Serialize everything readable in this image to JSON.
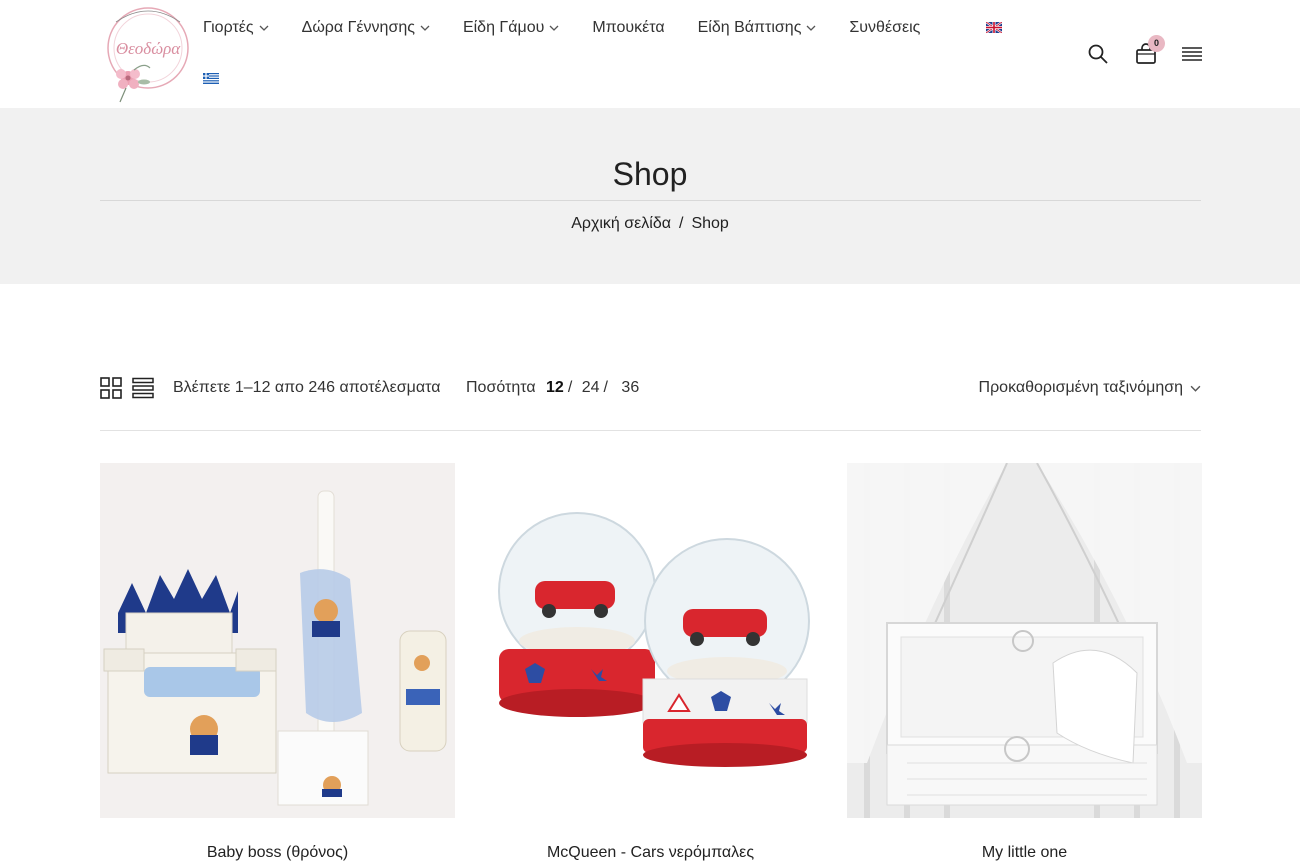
{
  "brand": {
    "logo_text": "Θεοδώρα",
    "logo_ring_text": "Floral Art & Event Design"
  },
  "nav": {
    "items": [
      {
        "label": "Γιορτές",
        "has_dropdown": true
      },
      {
        "label": "Δώρα Γέννησης",
        "has_dropdown": true
      },
      {
        "label": "Είδη Γάμου",
        "has_dropdown": true
      },
      {
        "label": "Μπουκέτα",
        "has_dropdown": false
      },
      {
        "label": "Είδη Βάπτισης",
        "has_dropdown": true
      },
      {
        "label": "Συνθέσεις",
        "has_dropdown": false
      }
    ],
    "languages": [
      "uk-flag-icon",
      "greek-flag-icon"
    ]
  },
  "header_icons": {
    "search": "search-icon",
    "cart": "cart-icon",
    "menu": "hamburger-menu-icon",
    "cart_count": "0"
  },
  "page": {
    "title": "Shop",
    "breadcrumb": {
      "home": "Αρχική σελίδα",
      "separator": "/",
      "current": "Shop"
    }
  },
  "toolbar": {
    "result_count": "Βλέπετε 1–12 απο 246 αποτέλεσματα",
    "quantity_label": "Ποσότητα",
    "quantity_options": [
      "12",
      "24",
      "36"
    ],
    "quantity_selected": "12",
    "sort_label": "Προκαθορισμένη ταξινόμηση"
  },
  "products": [
    {
      "name": "Baby boss (θρόνος)"
    },
    {
      "name": "McQueen - Cars νερόμπαλες"
    },
    {
      "name": "My little one"
    }
  ],
  "colors": {
    "accent_pink": "#e9b8c3",
    "band_bg": "#f1f1f1"
  }
}
